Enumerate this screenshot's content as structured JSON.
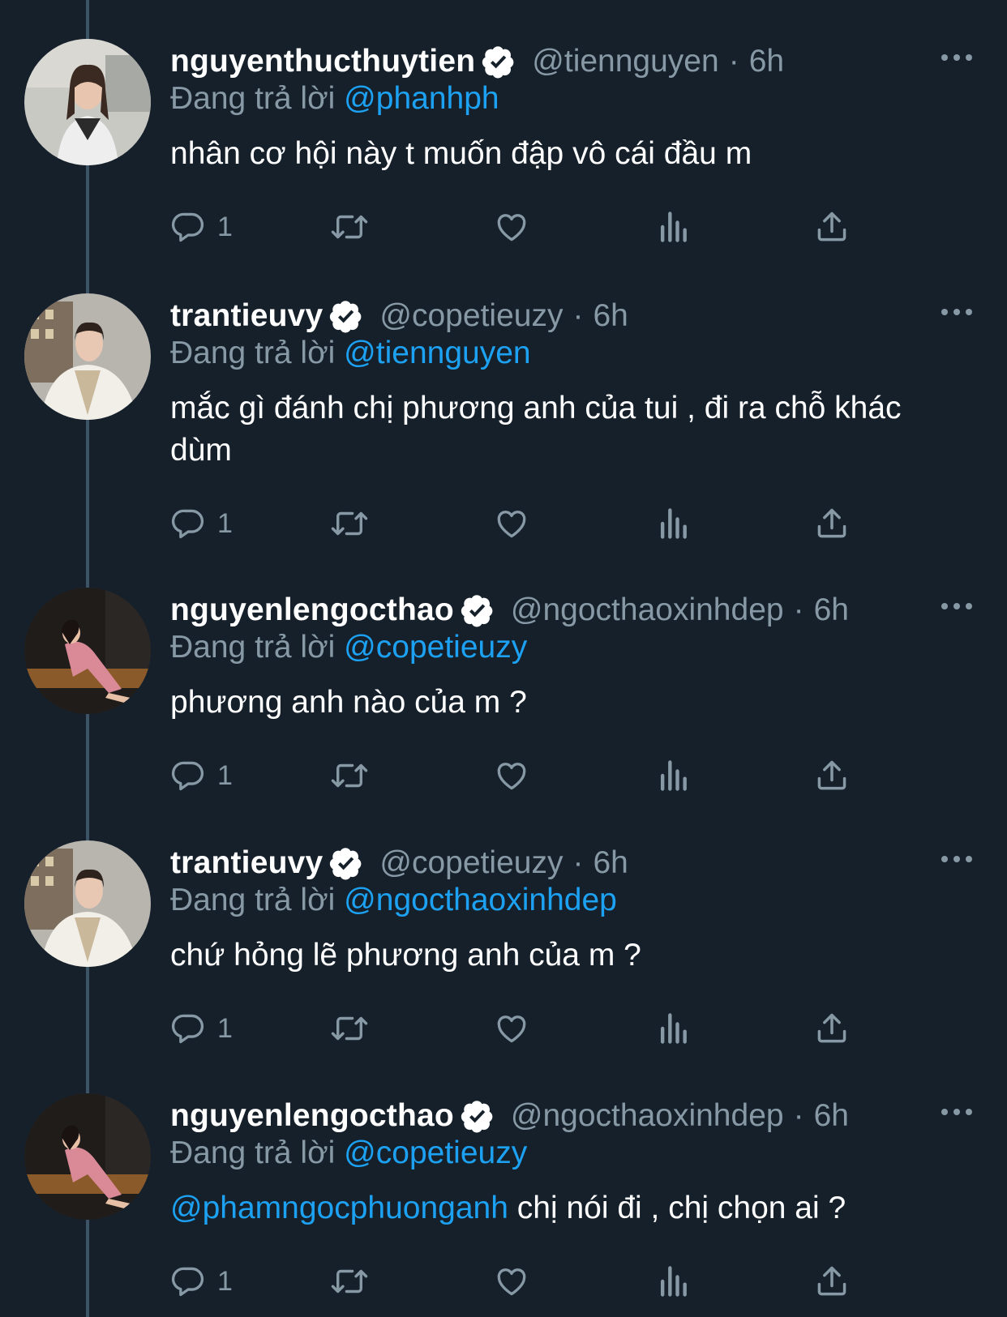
{
  "replying_prefix": "Đang trả lời",
  "tweets": [
    {
      "name": "nguyenthucthuytien",
      "handle": "@tiennguyen",
      "time": "6h",
      "replying_to": "@phanhph",
      "text": "nhân cơ hội này t muốn đập vô cái đầu m",
      "reply_count": "1",
      "avatar": "woman in white sweater vest"
    },
    {
      "name": "trantieuvy",
      "handle": "@copetieuzy",
      "time": "6h",
      "replying_to": "@tiennguyen",
      "text": "mắc gì đánh chị phương anh của tui , đi ra chỗ khác dùm",
      "reply_count": "1",
      "avatar": "woman in white fur and sparkling dress"
    },
    {
      "name": "nguyenlengocthao",
      "handle": "@ngocthaoxinhdep",
      "time": "6h",
      "replying_to": "@copetieuzy",
      "text": "phương anh nào của m ?",
      "reply_count": "1",
      "avatar": "woman in pink dress seated"
    },
    {
      "name": "trantieuvy",
      "handle": "@copetieuzy",
      "time": "6h",
      "replying_to": "@ngocthaoxinhdep",
      "text": "chứ hỏng lẽ phương anh của m ?",
      "reply_count": "1",
      "avatar": "woman in white fur and sparkling dress"
    },
    {
      "name": "nguyenlengocthao",
      "handle": "@ngocthaoxinhdep",
      "time": "6h",
      "replying_to": "@copetieuzy",
      "text_mention": "@phamngocphuonganh",
      "text": " chị nói đi , chị chọn ai ?",
      "reply_count": "1",
      "avatar": "woman in pink dress seated"
    }
  ],
  "icons": {
    "verified": "verified-badge-icon",
    "reply": "reply-icon",
    "retweet": "retweet-icon",
    "like": "like-icon",
    "analytics": "analytics-icon",
    "share": "share-icon",
    "more": "more-icon"
  },
  "colors": {
    "background": "#15202b",
    "secondary_text": "#8899a6",
    "link": "#1da1f2",
    "thread_line": "#3d5466"
  }
}
